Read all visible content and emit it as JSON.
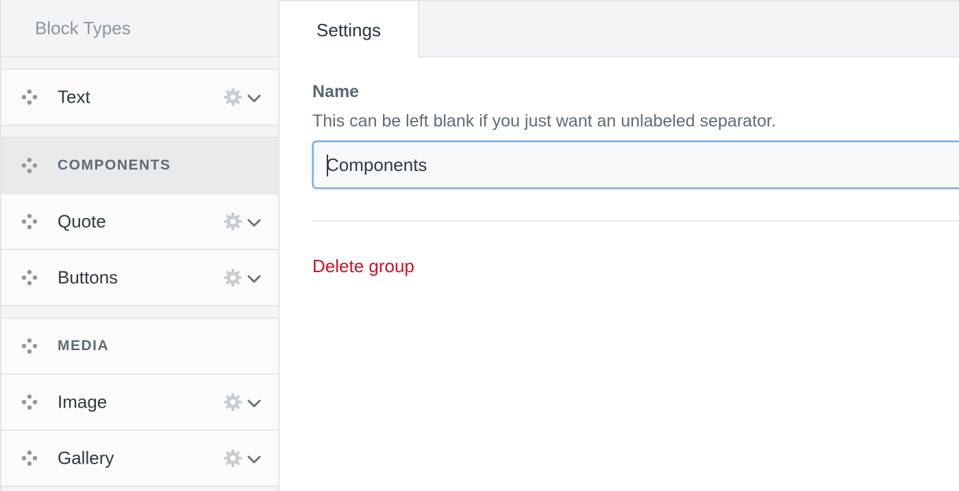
{
  "sidebar": {
    "header": "Block Types",
    "items": [
      {
        "kind": "block",
        "label": "Text",
        "icons": [
          "move-icon",
          "gear-icon",
          "chevron-down-icon"
        ]
      },
      {
        "kind": "group",
        "label": "COMPONENTS",
        "selected": true,
        "icons": [
          "move-icon"
        ]
      },
      {
        "kind": "block",
        "label": "Quote",
        "icons": [
          "move-icon",
          "gear-icon",
          "chevron-down-icon"
        ]
      },
      {
        "kind": "block",
        "label": "Buttons",
        "icons": [
          "move-icon",
          "gear-icon",
          "chevron-down-icon"
        ]
      },
      {
        "kind": "group",
        "label": "MEDIA",
        "icons": [
          "move-icon"
        ]
      },
      {
        "kind": "block",
        "label": "Image",
        "icons": [
          "move-icon",
          "gear-icon",
          "chevron-down-icon"
        ]
      },
      {
        "kind": "block",
        "label": "Gallery",
        "icons": [
          "move-icon",
          "gear-icon",
          "chevron-down-icon"
        ]
      }
    ]
  },
  "tabs": [
    {
      "label": "Settings",
      "active": true
    }
  ],
  "form": {
    "name_label": "Name",
    "name_hint": "This can be left blank if you just want an unlabeled separator.",
    "name_value": "Components"
  },
  "actions": {
    "delete_label": "Delete group"
  },
  "colors": {
    "sidebar_bg": "#f3f4f5",
    "selected_bg": "#e9eaeb",
    "border": "#e3e5e8",
    "input_focus": "#7fb0dd",
    "danger": "#cf1124"
  }
}
